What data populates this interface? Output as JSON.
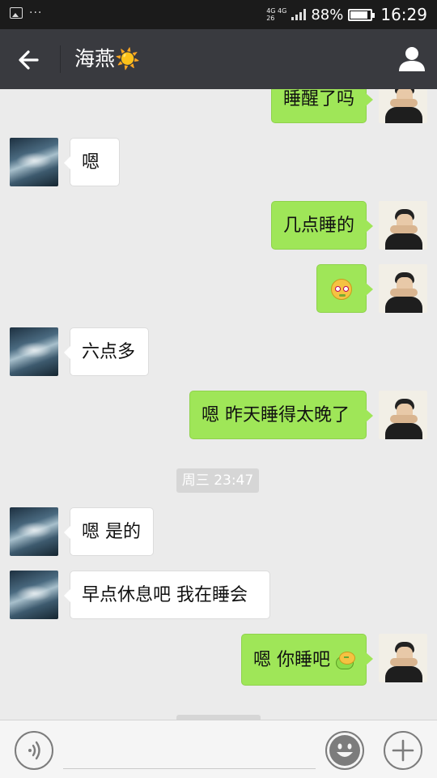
{
  "status_bar": {
    "notification_icons": [
      "image-icon",
      "more-dots"
    ],
    "network_top": "4G 4G",
    "network_bottom": "26",
    "battery_percent": "88%",
    "battery_level": 0.88,
    "time": "16:29"
  },
  "header": {
    "back_icon": "arrow-left-icon",
    "contact_name": "海燕☀️",
    "profile_icon": "person-icon"
  },
  "messages": [
    {
      "sender": "me",
      "text": "睡醒了吗"
    },
    {
      "sender": "friend",
      "text": "嗯"
    },
    {
      "sender": "me",
      "text": "几点睡的"
    },
    {
      "sender": "me",
      "text": "",
      "emoji": "sleepy-face-emoji"
    },
    {
      "sender": "friend",
      "text": "六点多"
    },
    {
      "sender": "me",
      "text": "嗯 昨天睡得太晚了"
    },
    {
      "type": "timestamp",
      "text": "周三 23:47"
    },
    {
      "sender": "friend",
      "text": "嗯 是的"
    },
    {
      "sender": "friend",
      "text": "早点休息吧 我在睡会"
    },
    {
      "sender": "me",
      "text": "嗯 你睡吧",
      "emoji": "pig-emoji"
    }
  ],
  "input_bar": {
    "voice_icon": "voice-icon",
    "input_value": "",
    "emoji_icon": "smiley-icon",
    "plus_icon": "plus-icon"
  },
  "colors": {
    "header_bg": "#393a3f",
    "chat_bg": "#ebebeb",
    "my_bubble": "#9fe658",
    "friend_bubble": "#ffffff"
  }
}
